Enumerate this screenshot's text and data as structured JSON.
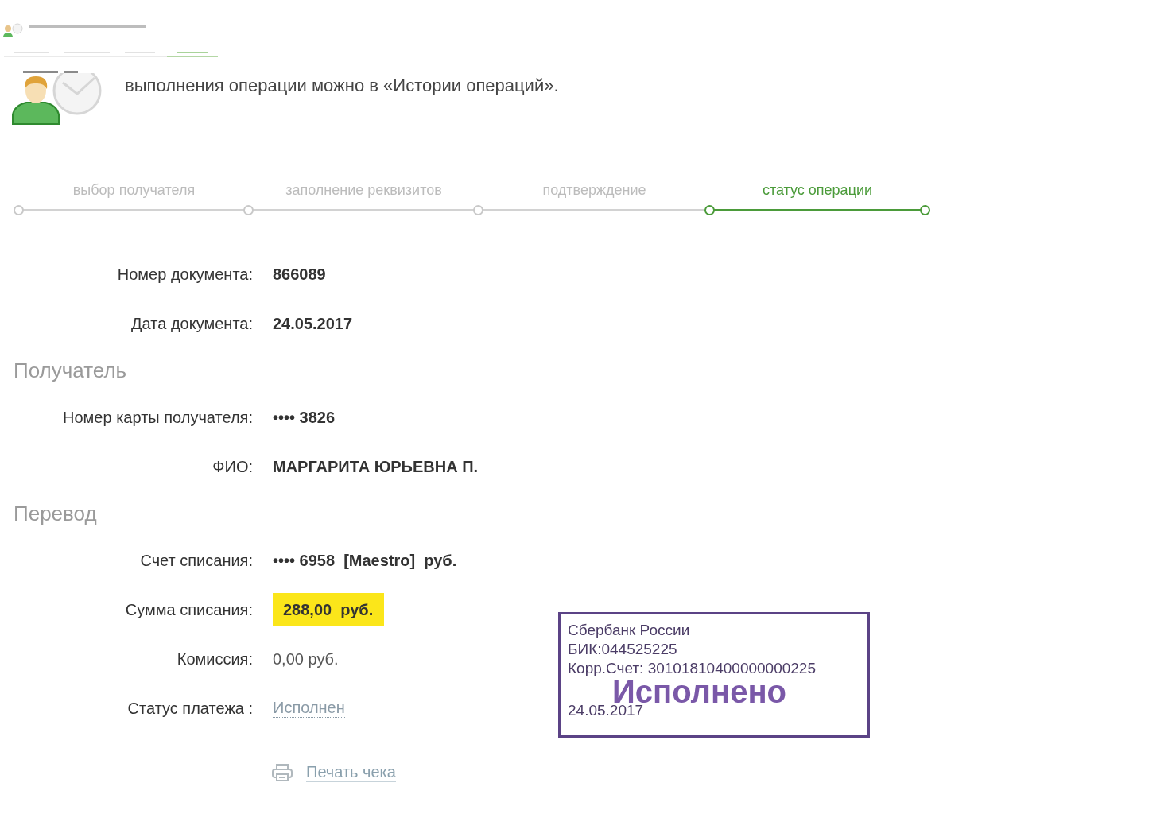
{
  "message": "выполнения операции можно в «Истории операций».",
  "steps": [
    {
      "label": "выбор получателя",
      "selected": false
    },
    {
      "label": "заполнение реквизитов",
      "selected": false
    },
    {
      "label": "подтверждение",
      "selected": false
    },
    {
      "label": "статус операции",
      "selected": true
    }
  ],
  "rows": [
    {
      "kind": "bold",
      "label": "Номер документа:",
      "value": "866089"
    },
    {
      "kind": "bold",
      "label": "Дата документа:",
      "value": "24.05.2017"
    },
    {
      "kind": "heading",
      "text": "Получатель"
    },
    {
      "kind": "bold",
      "label": "Номер карты получателя:",
      "value": "•••• 3826"
    },
    {
      "kind": "bold",
      "label": "ФИО:",
      "value": "МАРГАРИТА ЮРЬЕВНА П."
    },
    {
      "kind": "heading",
      "text": "Перевод"
    },
    {
      "kind": "bold",
      "label": "Счет списания:",
      "value": "•••• 6958  [Maestro]  руб."
    },
    {
      "kind": "highlight",
      "label": "Сумма списания:",
      "value": "288,00  руб."
    },
    {
      "kind": "plain",
      "label": "Комиссия:",
      "value": "0,00 руб."
    },
    {
      "kind": "status",
      "label": "Статус платежа :",
      "value": "Исполнен"
    }
  ],
  "print_link": "Печать чека",
  "stamp": {
    "bank": "Сбербанк России",
    "bik": "БИК:044525225",
    "account": "Корр.Счет: 30101810400000000225",
    "status": "Исполнено",
    "date": "24.05.2017"
  }
}
